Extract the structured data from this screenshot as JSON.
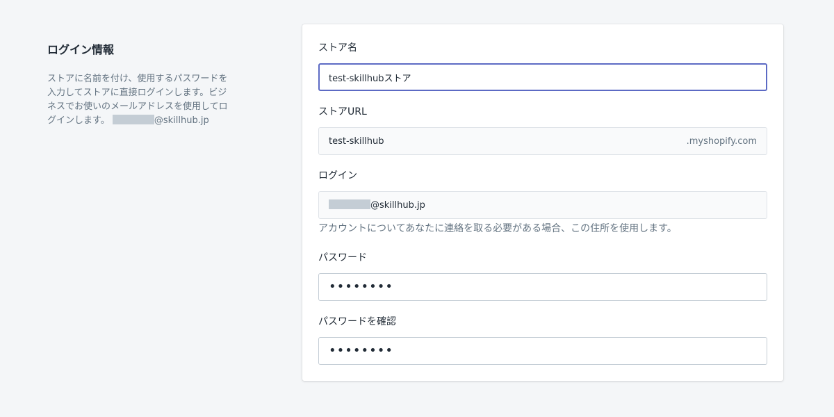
{
  "aside": {
    "title": "ログイン情報",
    "desc_line1": "ストアに名前を付け、使用するパスワードを",
    "desc_line2": "入力してストアに直接ログインします。ビジ",
    "desc_line3": "ネスでお使いのメールアドレスを使用してロ",
    "desc_line4_prefix": "グインします。",
    "desc_line4_email_domain": "@skillhub.jp"
  },
  "fields": {
    "store_name": {
      "label": "ストア名",
      "value": "test-skillhubストア"
    },
    "store_url": {
      "label": "ストアURL",
      "value": "test-skillhub",
      "suffix": ".myshopify.com"
    },
    "login": {
      "label": "ログイン",
      "email_domain": "@skillhub.jp",
      "help": "アカウントについてあなたに連絡を取る必要がある場合、この住所を使用します。"
    },
    "password": {
      "label": "パスワード",
      "value": "••••••••"
    },
    "password_confirm": {
      "label": "パスワードを確認",
      "value": "••••••••"
    }
  },
  "colors": {
    "background": "#f4f6f8",
    "focus_border": "#5c6ac4",
    "muted_text": "#637381",
    "redaction": "#c4cdd5"
  }
}
